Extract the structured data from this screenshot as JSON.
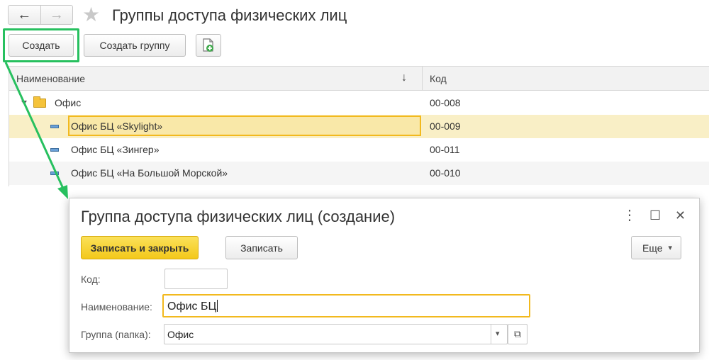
{
  "window": {
    "title": "Группы доступа физических лиц",
    "back_icon": "←",
    "forward_icon": "→",
    "star_icon": "★"
  },
  "toolbar": {
    "create_label": "Создать",
    "create_group_label": "Создать группу",
    "add_icon": "document-add-icon"
  },
  "grid": {
    "columns": {
      "name": "Наименование",
      "sort_icon": "↓",
      "code": "Код"
    },
    "rows": [
      {
        "name": "Офис",
        "code": "00-008",
        "type": "folder"
      },
      {
        "name": "Офис БЦ «Skylight»",
        "code": "00-009",
        "type": "item",
        "selected": true
      },
      {
        "name": "Офис БЦ «Зингер»",
        "code": "00-011",
        "type": "item"
      },
      {
        "name": "Офис БЦ «На Большой Морской»",
        "code": "00-010",
        "type": "item"
      }
    ]
  },
  "dialog": {
    "title": "Группа доступа физических лиц (создание)",
    "menu_icon": "⋮",
    "maximize_icon": "☐",
    "close_icon": "✕",
    "save_close_label": "Записать и закрыть",
    "save_label": "Записать",
    "more_label": "Еще",
    "more_icon": "▾",
    "fields": {
      "code_label": "Код:",
      "code_value": "",
      "name_label": "Наименование:",
      "name_value": "Офис БЦ",
      "group_label": "Группа (папка):",
      "group_value": "Офис",
      "dropdown_icon": "▾",
      "open_icon": "⧉"
    }
  },
  "colors": {
    "highlight": "#27c05f",
    "primary_button": "#f7d02c",
    "selection": "#f9e8a8",
    "focus_border": "#f2b91e"
  }
}
